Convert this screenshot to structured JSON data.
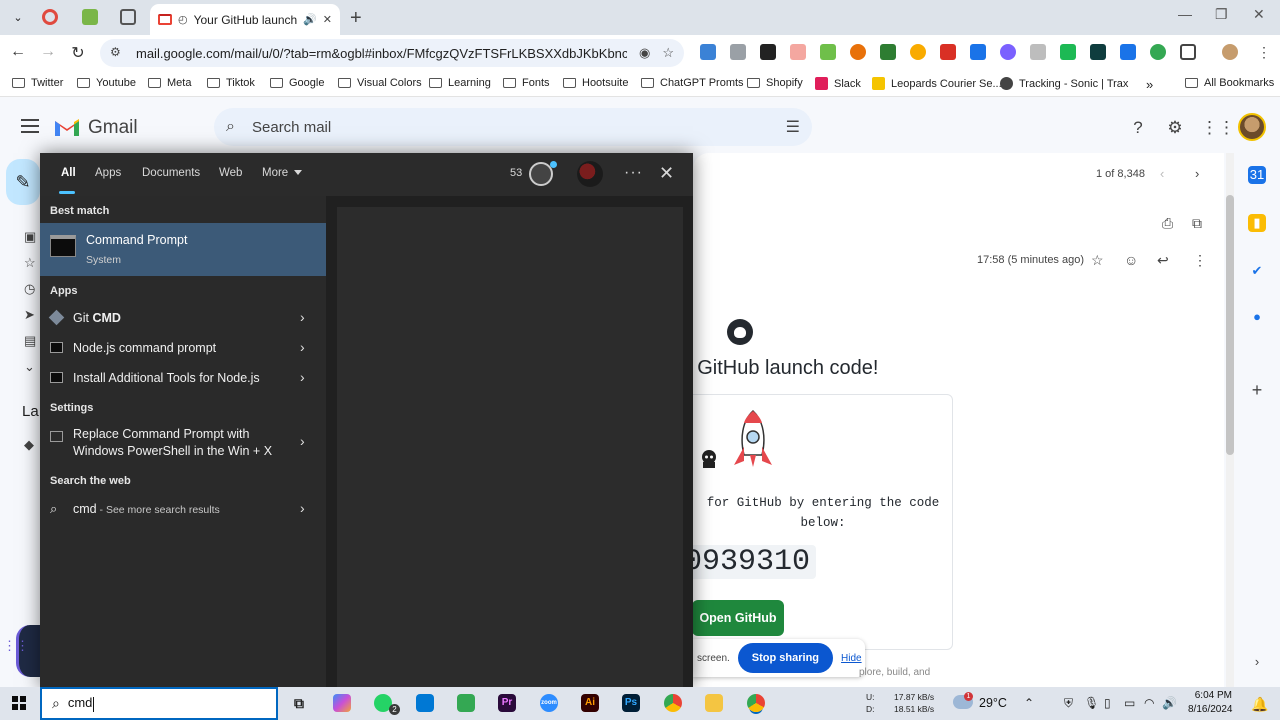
{
  "browser": {
    "active_tab_title": "Your GitHub launch code",
    "new_tab": "+",
    "window_controls": {
      "minimize": "—",
      "maximize": "❐",
      "close": "✕"
    },
    "url": "mail.google.com/mail/u/0/?tab=rm&ogbl#inbox/FMfcgzQVzFTSFrLKBSXXdbJKbKbncsGb",
    "nav": {
      "back": "←",
      "forward": "→",
      "reload": "↻"
    },
    "bookmarks": [
      {
        "label": "Twitter",
        "type": "folder"
      },
      {
        "label": "Youtube",
        "type": "folder"
      },
      {
        "label": "Meta",
        "type": "folder"
      },
      {
        "label": "Tiktok",
        "type": "folder"
      },
      {
        "label": "Google",
        "type": "folder"
      },
      {
        "label": "Visual Colors",
        "type": "folder"
      },
      {
        "label": "Learning",
        "type": "folder"
      },
      {
        "label": "Fonts",
        "type": "folder"
      },
      {
        "label": "Hootsuite",
        "type": "folder"
      },
      {
        "label": "ChatGPT Promts",
        "type": "folder"
      },
      {
        "label": "Shopify",
        "type": "folder"
      },
      {
        "label": "Slack",
        "type": "site"
      },
      {
        "label": "Leopards Courier Se...",
        "type": "site"
      },
      {
        "label": "Tracking - Sonic | Trax",
        "type": "site"
      }
    ],
    "bookmarks_overflow": "»",
    "all_bookmarks": "All Bookmarks"
  },
  "gmail": {
    "logo_text": "Gmail",
    "search_placeholder": "Search mail",
    "labels_peek": "La",
    "pager": "1 of 8,348",
    "timestamp": "17:58 (5 minutes ago)",
    "email": {
      "heading": "r GitHub launch code!",
      "body_line1": "for GitHub by entering the code",
      "body_line2": "below:",
      "code": "0939310",
      "button": "Open GitHub",
      "peek_text": "plore, build, and"
    },
    "share": {
      "text": "screen.",
      "stop": "Stop sharing",
      "hide": "Hide"
    }
  },
  "start_search": {
    "tabs": [
      "All",
      "Apps",
      "Documents",
      "Web",
      "More"
    ],
    "points": "53",
    "more_menu": "···",
    "close": "✕",
    "best_match_heading": "Best match",
    "best_match": {
      "name": "Command Prompt",
      "subtitle": "System"
    },
    "apps_heading": "Apps",
    "apps": [
      {
        "prefix": "Git ",
        "bold": "CMD"
      },
      {
        "prefix": "Node.js command prompt",
        "bold": ""
      },
      {
        "prefix": "Install Additional Tools for Node.js",
        "bold": ""
      }
    ],
    "settings_heading": "Settings",
    "settings_item": "Replace Command Prompt with Windows PowerShell in the Win + X",
    "web_heading": "Search the web",
    "web_item": {
      "query": "cmd",
      "suffix": " - See more search results"
    }
  },
  "taskbar": {
    "search_query": "cmd",
    "whatsapp_badge": "2",
    "net_up_label": "U:",
    "net_up": "17.87 kB/s",
    "net_down_label": "D:",
    "net_down": "18.51 kB/s",
    "weather_alert": "1",
    "temperature": "29°C",
    "time": "6:04 PM",
    "date": "8/16/2024"
  },
  "colors": {
    "start_bg": "#202020",
    "best_match_bg": "#3c5a78",
    "stop_sharing": "#0b57d0",
    "github_green": "#1f883d",
    "accent": "#4cc2ff"
  }
}
